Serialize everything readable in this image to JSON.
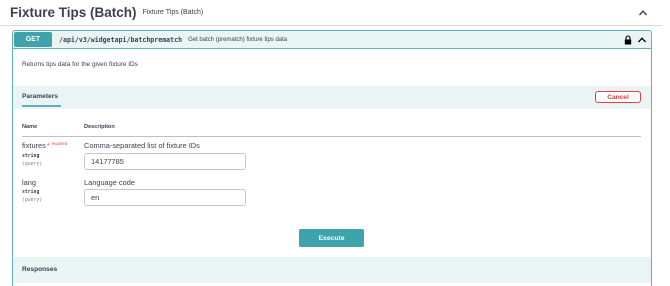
{
  "section": {
    "title": "Fixture Tips (Batch)",
    "description": "Fixture Tips (Batch)",
    "collapse_icon": "chevron-up-icon"
  },
  "operation": {
    "method": "GET",
    "path": "/api/v3/widgetapi/batchprematch",
    "summary": "Get batch (prematch) fixture tips data",
    "lock_icon": "lock-icon",
    "collapse_icon": "chevron-up-icon",
    "description": "Returns tips data for the given fixture IDs"
  },
  "parameters": {
    "tab_label": "Parameters",
    "cancel_label": "Cancel",
    "column_name": "Name",
    "column_description": "Description",
    "items": [
      {
        "name": "fixtures",
        "required_marker": "*",
        "required_label": "required",
        "type": "string",
        "in": "(query)",
        "description": "Comma-separated list of fixture IDs",
        "value": "14177785"
      },
      {
        "name": "lang",
        "type": "string",
        "in": "(query)",
        "description": "Language code",
        "value": "en"
      }
    ]
  },
  "execute_label": "Execute",
  "responses_label": "Responses",
  "colors": {
    "get_accent": "#3fa3ab",
    "get_background": "#eaf4f5",
    "cancel": "#e54242"
  }
}
